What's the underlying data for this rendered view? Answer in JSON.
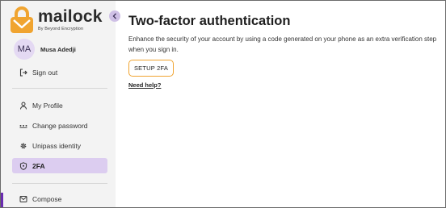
{
  "brand": {
    "name": "mailock",
    "tagline": "By Beyond Encryption",
    "accent": "#f0a430",
    "highlight": "#dccdf0"
  },
  "user": {
    "initials": "MA",
    "name": "Musa Adedji"
  },
  "sidebar": {
    "sign_out": {
      "label": "Sign out",
      "icon": "sign-out-icon"
    },
    "items": [
      {
        "label": "My Profile",
        "icon": "person-icon",
        "active": false
      },
      {
        "label": "Change password",
        "icon": "password-dots-icon",
        "active": false
      },
      {
        "label": "Unipass identity",
        "icon": "gear-icon",
        "active": false
      },
      {
        "label": "2FA",
        "icon": "shield-icon",
        "active": true
      }
    ],
    "compose": {
      "label": "Compose",
      "icon": "compose-icon"
    }
  },
  "main": {
    "title": "Two-factor authentication",
    "description": "Enhance the security of your account by using a code generated on your phone as an extra verification step when you sign in.",
    "setup_button": "SETUP 2FA",
    "help_link": "Need help?"
  }
}
